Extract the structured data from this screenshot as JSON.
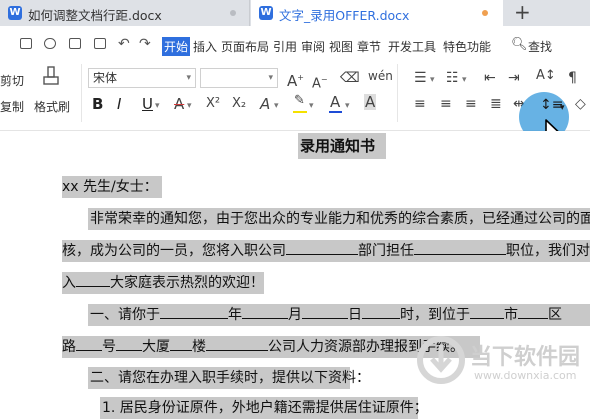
{
  "tabs": [
    {
      "label": "如何调整文档行距.docx",
      "active": false
    },
    {
      "label": "文字_录用OFFER.docx",
      "active": true
    }
  ],
  "new_tab_label": "+",
  "menu": {
    "items": [
      "开始",
      "插入",
      "页面布局",
      "引用",
      "审阅",
      "视图",
      "章节",
      "开发工具",
      "特色功能"
    ],
    "active": "开始",
    "search_label": "查找"
  },
  "ribbon": {
    "cut_label": "剪切",
    "copy_label": "复制",
    "format_painter_label": "格式刷",
    "font_name": "宋体",
    "font_size": "",
    "format_buttons": [
      "B",
      "I",
      "U",
      "A",
      "X²",
      "X₂",
      "A",
      "A",
      "A"
    ],
    "accent_color": "#2f6fde",
    "font_color": "#1e4cd6",
    "highlight_color": "#f5e100",
    "strike_color": "#d23a3a"
  },
  "document": {
    "title": "录用通知书",
    "salutation": "xx 先生/女士：",
    "para1_line1": "非常荣幸的通知您，由于您出众的专业能力和优秀的综合素质，已经通过公司的面",
    "para1_line2_a": "核，成为公司的一员，您将入职公司",
    "para1_line2_b": "部门担任",
    "para1_line2_c": "职位，我们对",
    "para1_line3_a": "入",
    "para1_line3_b": "大家庭表示热烈的欢迎！",
    "item1_line1_a": "一、请你于",
    "item1_line1_b": "年",
    "item1_line1_c": "月",
    "item1_line1_d": "日",
    "item1_line1_e": "时，到位于",
    "item1_line1_f": "市",
    "item1_line1_g": "区",
    "item1_line2_a": "路",
    "item1_line2_b": "号",
    "item1_line2_c": "大厦",
    "item1_line2_d": "楼",
    "item1_line2_e": "公司人力资源部办理报到手续。",
    "item2_line1": "二、请您在办理入职手续时，提供以下资料：",
    "item2_sub1": "1. 居民身份证原件，外地户籍还需提供居住证原件；"
  },
  "watermark": {
    "name": "当下软件园",
    "url": "www.downxia.com"
  }
}
